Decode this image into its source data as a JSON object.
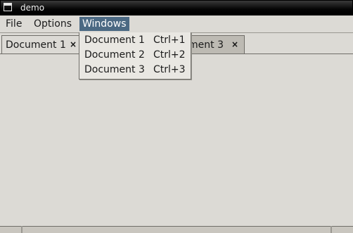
{
  "window": {
    "title": "demo"
  },
  "menubar": {
    "items": [
      {
        "label": "File"
      },
      {
        "label": "Options"
      },
      {
        "label": "Windows",
        "active": true
      }
    ]
  },
  "tabs": [
    {
      "label": "Document 1",
      "close_glyph": "×"
    },
    {
      "label": "ment 3",
      "close_glyph": "×"
    }
  ],
  "windows_menu": {
    "items": [
      {
        "label": "Document 1",
        "accelerator": "Ctrl+1"
      },
      {
        "label": "Document 2",
        "accelerator": "Ctrl+2"
      },
      {
        "label": "Document 3",
        "accelerator": "Ctrl+3"
      }
    ]
  },
  "colors": {
    "menu_highlight": "#4b6983",
    "background": "#dcdad5"
  }
}
